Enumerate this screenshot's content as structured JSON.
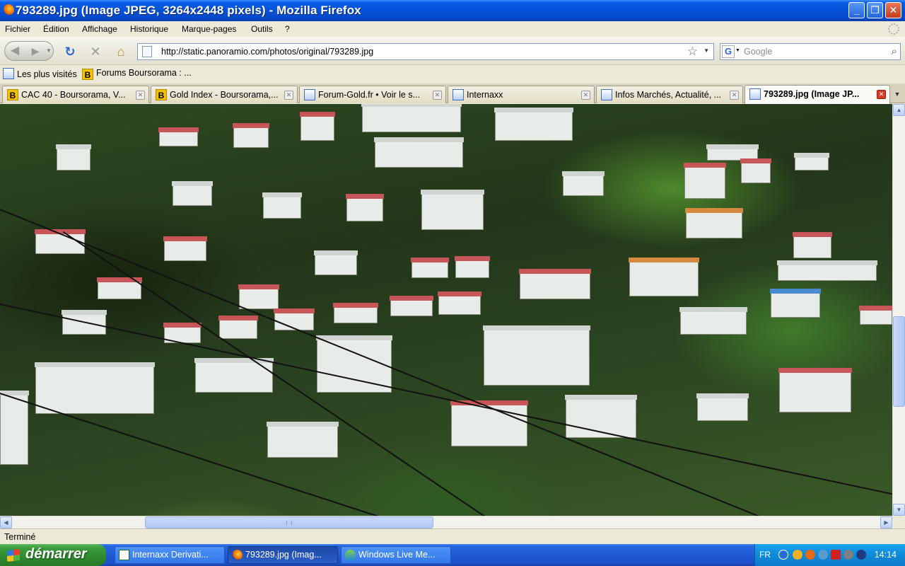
{
  "window": {
    "title": "793289.jpg (Image JPEG, 3264x2448 pixels) - Mozilla Firefox",
    "buttons": {
      "minimize": "_",
      "maximize": "❐",
      "close": "✕"
    }
  },
  "menu": [
    {
      "label": "Fichier"
    },
    {
      "label": "Édition"
    },
    {
      "label": "Affichage"
    },
    {
      "label": "Historique"
    },
    {
      "label": "Marque-pages"
    },
    {
      "label": "Outils"
    },
    {
      "label": "?"
    }
  ],
  "nav": {
    "url": "http://static.panoramio.com/photos/original/793289.jpg",
    "search_placeholder": "Google",
    "search_engine_letter": "G",
    "icons": [
      "back-icon",
      "forward-icon",
      "reload-icon",
      "stop-icon",
      "home-icon",
      "bookmark-star-icon",
      "search-icon"
    ]
  },
  "bookmarks": [
    {
      "label": "Les plus visités",
      "icon": "page-icon"
    },
    {
      "label": "Forums Boursorama : ...",
      "icon": "boursorama-b-icon",
      "letter": "B"
    }
  ],
  "tabs": [
    {
      "label": "CAC 40 - Boursorama, V...",
      "icon": "B",
      "active": false
    },
    {
      "label": "Gold Index - Boursorama,...",
      "icon": "B",
      "active": false
    },
    {
      "label": "Forum-Gold.fr • Voir le s...",
      "icon": "page",
      "active": false
    },
    {
      "label": "Internaxx",
      "icon": "page",
      "active": false
    },
    {
      "label": "Infos Marchés, Actualité, ...",
      "icon": "page",
      "active": false
    },
    {
      "label": "793289.jpg (Image JP...",
      "icon": "page",
      "active": true
    }
  ],
  "content": {
    "type": "image",
    "alt_semantic": "aerial-hillside-photo"
  },
  "status": {
    "text": "Terminé"
  },
  "taskbar": {
    "start_label": "démarrer",
    "tasks": [
      {
        "label": "Internaxx Derivati...",
        "active": false,
        "icon": "excel-icon"
      },
      {
        "label": "793289.jpg (Imag...",
        "active": true,
        "icon": "firefox-icon"
      },
      {
        "label": "Windows Live Me...",
        "active": false,
        "icon": "messenger-icon"
      }
    ],
    "tray": {
      "language": "FR",
      "clock": "14:14"
    }
  },
  "colors": {
    "titlebar": "#0653d8",
    "taskbar": "#1f5ad4",
    "start": "#3c9a3c",
    "chrome": "#ece9d8"
  }
}
